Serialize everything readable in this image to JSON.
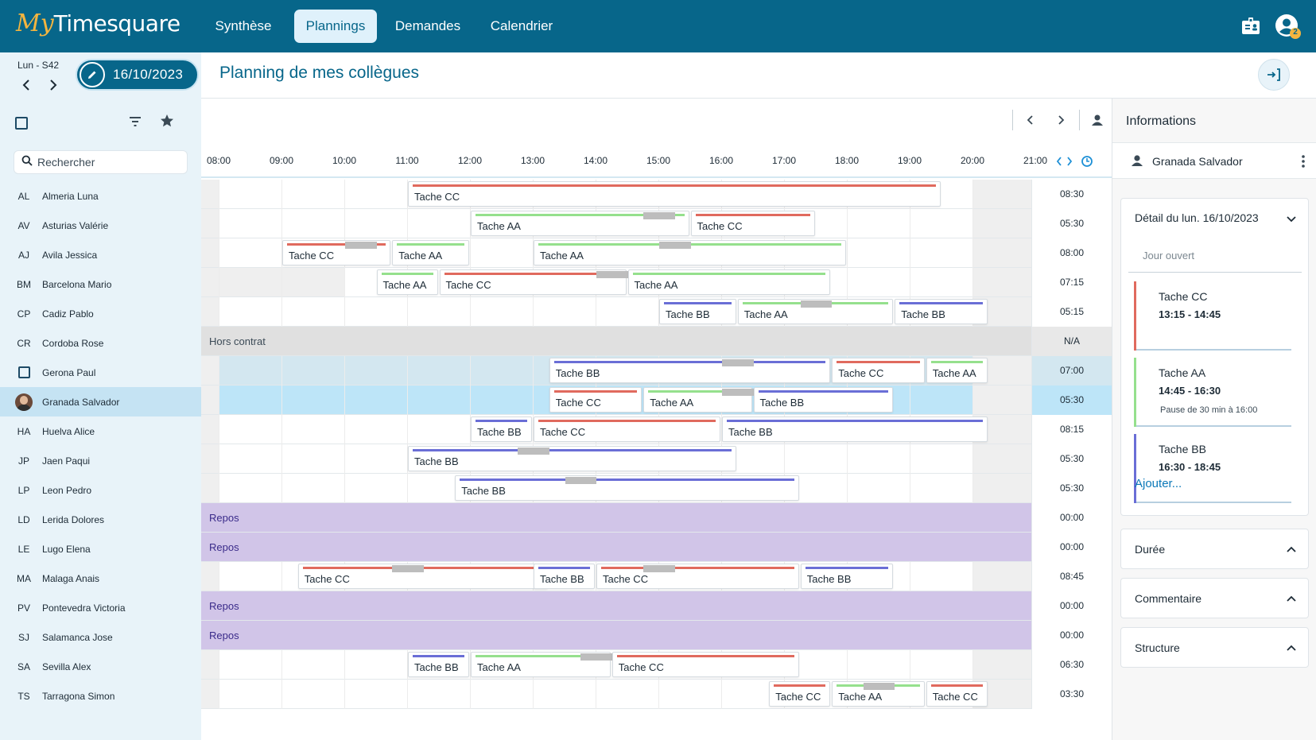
{
  "app": {
    "logo_my": "My",
    "logo_name": "Timesquare"
  },
  "nav": {
    "tabs": [
      {
        "label": "Synthèse"
      },
      {
        "label": "Plannings"
      },
      {
        "label": "Demandes"
      },
      {
        "label": "Calendrier"
      }
    ],
    "active": "Plannings",
    "notification_count": "2"
  },
  "date_bar": {
    "day_week": "Lun - S42",
    "date": "16/10/2023"
  },
  "page": {
    "title": "Planning de mes collègues"
  },
  "sidebar": {
    "search_placeholder": "Rechercher",
    "employees": [
      {
        "initials": "AL",
        "name": "Almeria Luna"
      },
      {
        "initials": "AV",
        "name": "Asturias Valérie"
      },
      {
        "initials": "AJ",
        "name": "Avila Jessica"
      },
      {
        "initials": "BM",
        "name": "Barcelona Mario"
      },
      {
        "initials": "CP",
        "name": "Cadiz Pablo"
      },
      {
        "initials": "CR",
        "name": "Cordoba Rose"
      },
      {
        "initials": "",
        "name": "Gerona Paul"
      },
      {
        "initials": "",
        "name": "Granada Salvador"
      },
      {
        "initials": "HA",
        "name": "Huelva Alice"
      },
      {
        "initials": "JP",
        "name": "Jaen Paqui"
      },
      {
        "initials": "LP",
        "name": "Leon Pedro"
      },
      {
        "initials": "LD",
        "name": "Lerida Dolores"
      },
      {
        "initials": "LE",
        "name": "Lugo Elena"
      },
      {
        "initials": "MA",
        "name": "Malaga Anais"
      },
      {
        "initials": "PV",
        "name": "Pontevedra Victoria"
      },
      {
        "initials": "SJ",
        "name": "Salamanca Jose"
      },
      {
        "initials": "SA",
        "name": "Sevilla Alex"
      },
      {
        "initials": "TS",
        "name": "Tarragona Simon"
      }
    ],
    "selected": "Granada Salvador"
  },
  "timeline": {
    "hours": [
      "08:00",
      "09:00",
      "10:00",
      "11:00",
      "12:00",
      "13:00",
      "14:00",
      "15:00",
      "16:00",
      "17:00",
      "18:00",
      "19:00",
      "20:00",
      "21:00"
    ],
    "rows": [
      {
        "total": "08:30",
        "tasks": [
          {
            "label": "Tache CC",
            "type": "cc",
            "start": "11:00",
            "end": "19:30"
          }
        ]
      },
      {
        "total": "05:30",
        "tasks": [
          {
            "label": "Tache AA",
            "type": "aa",
            "start": "12:00",
            "end": "15:30",
            "pause": "14:45"
          },
          {
            "label": "Tache CC",
            "type": "cc",
            "start": "15:30",
            "end": "17:30"
          }
        ]
      },
      {
        "total": "08:00",
        "tasks": [
          {
            "label": "Tache CC",
            "type": "cc",
            "start": "09:00",
            "end": "10:45",
            "pause": "10:00"
          },
          {
            "label": "Tache AA",
            "type": "aa",
            "start": "10:45",
            "end": "12:00"
          },
          {
            "label": "Tache AA",
            "type": "aa",
            "start": "13:00",
            "end": "18:00",
            "pause": "15:00"
          }
        ]
      },
      {
        "total": "07:15",
        "tasks": [
          {
            "label": "Tache AA",
            "type": "aa",
            "start": "10:30",
            "end": "11:30"
          },
          {
            "label": "Tache CC",
            "type": "cc",
            "start": "11:30",
            "end": "14:30",
            "pause": "14:00"
          },
          {
            "label": "Tache AA",
            "type": "aa",
            "start": "14:30",
            "end": "17:45"
          }
        ]
      },
      {
        "total": "05:15",
        "tasks": [
          {
            "label": "Tache BB",
            "type": "bb",
            "start": "15:00",
            "end": "16:15"
          },
          {
            "label": "Tache AA",
            "type": "aa",
            "start": "16:15",
            "end": "18:45",
            "pause": "17:15"
          },
          {
            "label": "Tache BB",
            "type": "bb",
            "start": "18:45",
            "end": "20:15"
          }
        ]
      },
      {
        "total": "N/A",
        "label": "Hors contrat",
        "kind": "hors",
        "tasks": []
      },
      {
        "total": "07:00",
        "tasks": [
          {
            "label": "Tache BB",
            "type": "bb",
            "start": "13:15",
            "end": "17:45",
            "pause": "16:00"
          },
          {
            "label": "Tache CC",
            "type": "cc",
            "start": "17:45",
            "end": "19:15"
          },
          {
            "label": "Tache AA",
            "type": "aa",
            "start": "19:15",
            "end": "20:15"
          }
        ]
      },
      {
        "total": "05:30",
        "tasks": [
          {
            "label": "Tache CC",
            "type": "cc",
            "start": "13:15",
            "end": "14:45"
          },
          {
            "label": "Tache AA",
            "type": "aa",
            "start": "14:45",
            "end": "16:30",
            "pause": "16:00"
          },
          {
            "label": "Tache BB",
            "type": "bb",
            "start": "16:30",
            "end": "18:45"
          }
        ]
      },
      {
        "total": "08:15",
        "tasks": [
          {
            "label": "Tache BB",
            "type": "bb",
            "start": "12:00",
            "end": "13:00"
          },
          {
            "label": "Tache CC",
            "type": "cc",
            "start": "13:00",
            "end": "16:00"
          },
          {
            "label": "Tache BB",
            "type": "bb",
            "start": "16:00",
            "end": "20:15"
          }
        ]
      },
      {
        "total": "05:30",
        "tasks": [
          {
            "label": "Tache BB",
            "type": "bb",
            "start": "11:00",
            "end": "16:15",
            "pause": "12:45"
          }
        ]
      },
      {
        "total": "05:30",
        "tasks": [
          {
            "label": "Tache BB",
            "type": "bb",
            "start": "11:45",
            "end": "17:15",
            "pause": "13:30"
          }
        ]
      },
      {
        "total": "00:00",
        "label": "Repos",
        "kind": "repos",
        "tasks": []
      },
      {
        "total": "00:00",
        "label": "Repos",
        "kind": "repos",
        "tasks": []
      },
      {
        "total": "08:45",
        "tasks": [
          {
            "label": "Tache CC",
            "type": "cc",
            "start": "09:15",
            "end": "13:15",
            "pause": "10:45"
          },
          {
            "label": "Tache BB",
            "type": "bb",
            "start": "13:00",
            "end": "14:00"
          },
          {
            "label": "Tache CC",
            "type": "cc",
            "start": "14:00",
            "end": "17:15",
            "pause": "14:45"
          },
          {
            "label": "Tache BB",
            "type": "bb",
            "start": "17:15",
            "end": "18:45"
          }
        ]
      },
      {
        "total": "00:00",
        "label": "Repos",
        "kind": "repos",
        "tasks": []
      },
      {
        "total": "00:00",
        "label": "Repos",
        "kind": "repos",
        "tasks": []
      },
      {
        "total": "06:30",
        "tasks": [
          {
            "label": "Tache BB",
            "type": "bb",
            "start": "11:00",
            "end": "12:00"
          },
          {
            "label": "Tache AA",
            "type": "aa",
            "start": "12:00",
            "end": "14:15",
            "pause": "13:45"
          },
          {
            "label": "Tache CC",
            "type": "cc",
            "start": "14:15",
            "end": "17:15"
          }
        ]
      },
      {
        "total": "03:30",
        "tasks": [
          {
            "label": "Tache CC",
            "type": "cc",
            "start": "16:45",
            "end": "17:45"
          },
          {
            "label": "Tache AA",
            "type": "aa",
            "start": "17:45",
            "end": "19:15",
            "pause": "18:15"
          },
          {
            "label": "Tache CC",
            "type": "cc",
            "start": "19:15",
            "end": "20:15"
          }
        ]
      }
    ]
  },
  "info_panel": {
    "title": "Informations",
    "user": "Granada Salvador",
    "detail_title": "Détail du lun. 16/10/2023",
    "jour_status": "Jour ouvert",
    "tasks": [
      {
        "name": "Tache CC",
        "time": "13:15 - 14:45",
        "pause": "",
        "color": "#e06a5e"
      },
      {
        "name": "Tache AA",
        "time": "14:45 - 16:30",
        "pause": "Pause de 30 min à 16:00",
        "color": "#95e08d"
      },
      {
        "name": "Tache BB",
        "time": "16:30 - 18:45",
        "pause": "",
        "color": "#6a6ed6"
      }
    ],
    "add_label": "Ajouter...",
    "sections": [
      "Durée",
      "Commentaire",
      "Structure"
    ]
  },
  "colors": {
    "primary": "#07668a",
    "tache_cc": "#e06a5e",
    "tache_aa": "#95e08d",
    "tache_bb": "#6a6ed6",
    "repos": "#d1c5e8",
    "selected_row": "#bde5f8"
  }
}
